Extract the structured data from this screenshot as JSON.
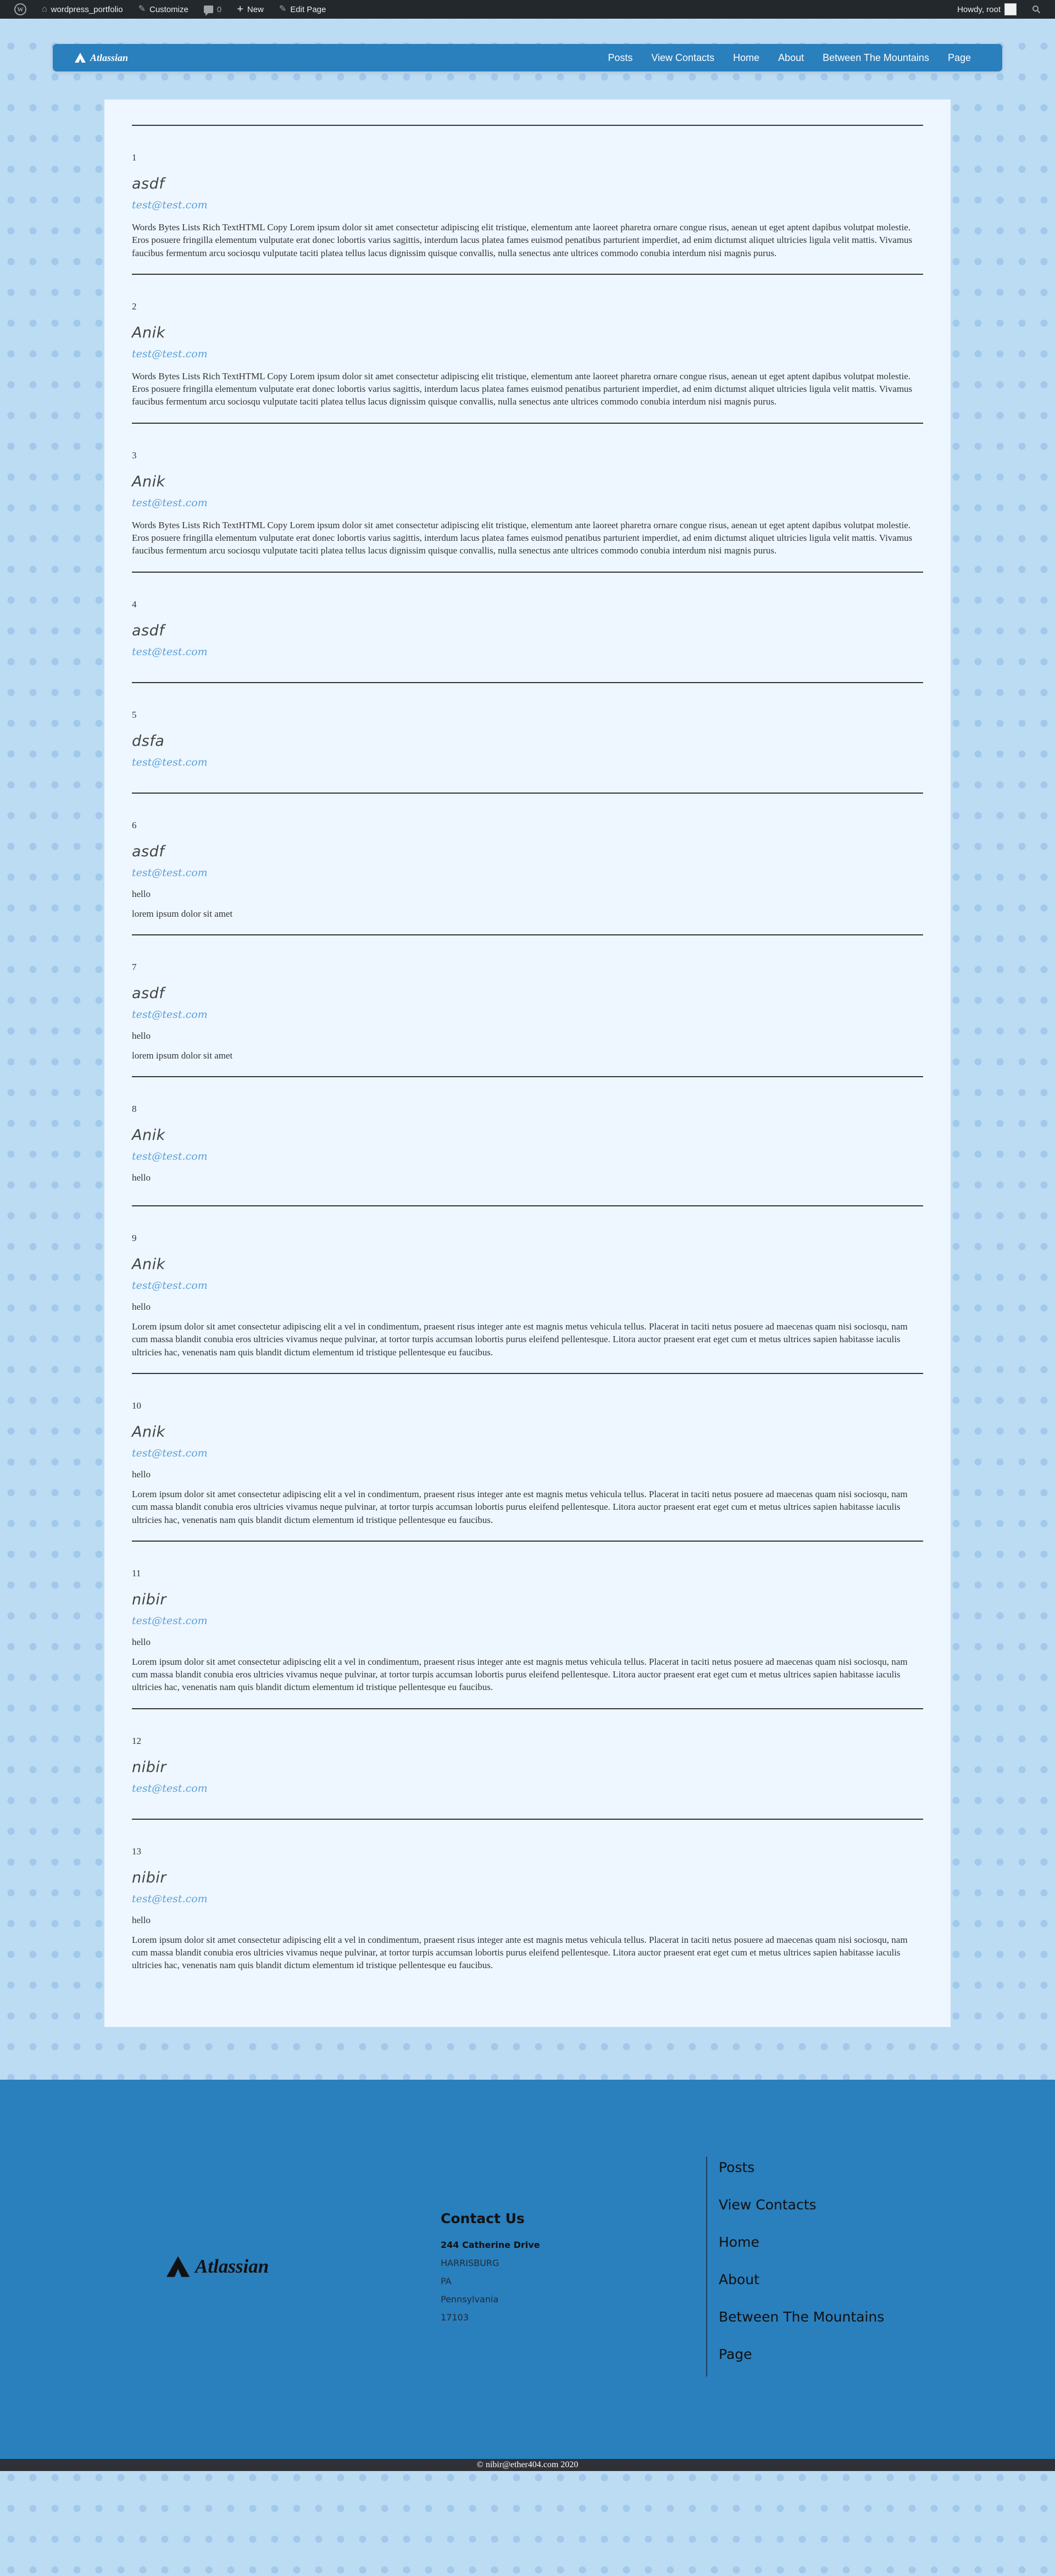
{
  "adminbar": {
    "site_name": "wordpress_portfolio",
    "customize": "Customize",
    "comments": "0",
    "new": "New",
    "edit_page": "Edit Page",
    "howdy": "Howdy, root"
  },
  "nav": {
    "brand": "Atlassian",
    "links": [
      "Posts",
      "View Contacts",
      "Home",
      "About",
      "Between The Mountains",
      "Page"
    ]
  },
  "entries": [
    {
      "num": "1",
      "name": "asdf",
      "email": "test@test.com",
      "msg": "",
      "body": "Words Bytes Lists Rich TextHTML Copy Lorem ipsum dolor sit amet consectetur adipiscing elit tristique, elementum ante laoreet pharetra ornare congue risus, aenean ut eget aptent dapibus volutpat molestie. Eros posuere fringilla elementum vulputate erat donec lobortis varius sagittis, interdum lacus platea fames euismod penatibus parturient imperdiet, ad enim dictumst aliquet ultricies ligula velit mattis. Vivamus faucibus fermentum arcu sociosqu vulputate taciti platea tellus lacus dignissim quisque convallis, nulla senectus ante ultrices commodo conubia interdum nisi magnis purus."
    },
    {
      "num": "2",
      "name": "Anik",
      "email": "test@test.com",
      "msg": "",
      "body": "Words Bytes Lists Rich TextHTML Copy Lorem ipsum dolor sit amet consectetur adipiscing elit tristique, elementum ante laoreet pharetra ornare congue risus, aenean ut eget aptent dapibus volutpat molestie. Eros posuere fringilla elementum vulputate erat donec lobortis varius sagittis, interdum lacus platea fames euismod penatibus parturient imperdiet, ad enim dictumst aliquet ultricies ligula velit mattis. Vivamus faucibus fermentum arcu sociosqu vulputate taciti platea tellus lacus dignissim quisque convallis, nulla senectus ante ultrices commodo conubia interdum nisi magnis purus."
    },
    {
      "num": "3",
      "name": "Anik",
      "email": "test@test.com",
      "msg": "",
      "body": "Words Bytes Lists Rich TextHTML Copy Lorem ipsum dolor sit amet consectetur adipiscing elit tristique, elementum ante laoreet pharetra ornare congue risus, aenean ut eget aptent dapibus volutpat molestie. Eros posuere fringilla elementum vulputate erat donec lobortis varius sagittis, interdum lacus platea fames euismod penatibus parturient imperdiet, ad enim dictumst aliquet ultricies ligula velit mattis. Vivamus faucibus fermentum arcu sociosqu vulputate taciti platea tellus lacus dignissim quisque convallis, nulla senectus ante ultrices commodo conubia interdum nisi magnis purus."
    },
    {
      "num": "4",
      "name": "asdf",
      "email": "test@test.com",
      "msg": "",
      "body": ""
    },
    {
      "num": "5",
      "name": "dsfa",
      "email": "test@test.com",
      "msg": "",
      "body": ""
    },
    {
      "num": "6",
      "name": "asdf",
      "email": "test@test.com",
      "msg": "hello",
      "body": "lorem ipsum dolor sit amet"
    },
    {
      "num": "7",
      "name": "asdf",
      "email": "test@test.com",
      "msg": "hello",
      "body": "lorem ipsum dolor sit amet"
    },
    {
      "num": "8",
      "name": "Anik",
      "email": "test@test.com",
      "msg": "hello",
      "body": ""
    },
    {
      "num": "9",
      "name": "Anik",
      "email": "test@test.com",
      "msg": "hello",
      "body": "Lorem ipsum dolor sit amet consectetur adipiscing elit a vel in condimentum, praesent risus integer ante est magnis metus vehicula tellus. Placerat in taciti netus posuere ad maecenas quam nisi sociosqu, nam cum massa blandit conubia eros ultricies vivamus neque pulvinar, at tortor turpis accumsan lobortis purus eleifend pellentesque. Litora auctor praesent erat eget cum et metus ultrices sapien habitasse iaculis ultricies hac, venenatis nam quis blandit dictum elementum id tristique pellentesque eu faucibus."
    },
    {
      "num": "10",
      "name": "Anik",
      "email": "test@test.com",
      "msg": "hello",
      "body": "Lorem ipsum dolor sit amet consectetur adipiscing elit a vel in condimentum, praesent risus integer ante est magnis metus vehicula tellus. Placerat in taciti netus posuere ad maecenas quam nisi sociosqu, nam cum massa blandit conubia eros ultricies vivamus neque pulvinar, at tortor turpis accumsan lobortis purus eleifend pellentesque. Litora auctor praesent erat eget cum et metus ultrices sapien habitasse iaculis ultricies hac, venenatis nam quis blandit dictum elementum id tristique pellentesque eu faucibus."
    },
    {
      "num": "11",
      "name": "nibir",
      "email": "test@test.com",
      "msg": "hello",
      "body": "Lorem ipsum dolor sit amet consectetur adipiscing elit a vel in condimentum, praesent risus integer ante est magnis metus vehicula tellus. Placerat in taciti netus posuere ad maecenas quam nisi sociosqu, nam cum massa blandit conubia eros ultricies vivamus neque pulvinar, at tortor turpis accumsan lobortis purus eleifend pellentesque. Litora auctor praesent erat eget cum et metus ultrices sapien habitasse iaculis ultricies hac, venenatis nam quis blandit dictum elementum id tristique pellentesque eu faucibus."
    },
    {
      "num": "12",
      "name": "nibir",
      "email": "test@test.com",
      "msg": "",
      "body": ""
    },
    {
      "num": "13",
      "name": "nibir",
      "email": "test@test.com",
      "msg": "hello",
      "body": "Lorem ipsum dolor sit amet consectetur adipiscing elit a vel in condimentum, praesent risus integer ante est magnis metus vehicula tellus. Placerat in taciti netus posuere ad maecenas quam nisi sociosqu, nam cum massa blandit conubia eros ultricies vivamus neque pulvinar, at tortor turpis accumsan lobortis purus eleifend pellentesque. Litora auctor praesent erat eget cum et metus ultrices sapien habitasse iaculis ultricies hac, venenatis nam quis blandit dictum elementum id tristique pellentesque eu faucibus."
    }
  ],
  "footer": {
    "brand": "Atlassian",
    "contact_title": "Contact Us",
    "street": "244 Catherine Drive",
    "city": "HARRISBURG",
    "state_abbr": "PA",
    "state": "Pennsylvania",
    "zip": "17103",
    "links": [
      "Posts",
      "View Contacts",
      "Home",
      "About",
      "Between The Mountains",
      "Page"
    ],
    "copyright": "© nibir@ether404.com 2020"
  },
  "colors": {
    "primary": "#2a7fbd",
    "background": "#bcdcf4",
    "card": "#eef7ff",
    "email": "#5aa0d8",
    "adminbar": "#23282d"
  }
}
